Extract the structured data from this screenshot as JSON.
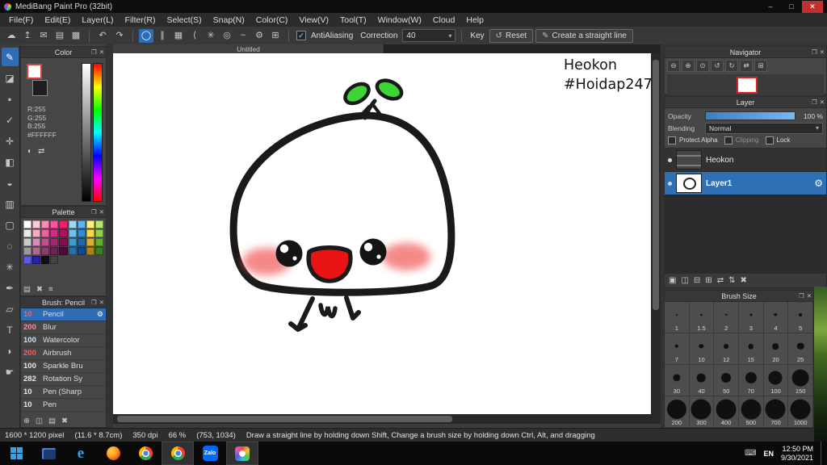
{
  "window": {
    "title": "MediBang Paint Pro (32bit)"
  },
  "glyphs": {
    "minimize": "–",
    "maximize": "□",
    "close": "✕",
    "popout": "❐",
    "undo": "↶",
    "redo": "↷",
    "caret": "▾",
    "check": "✓",
    "gear": "⚙",
    "reset_arrow": "↺",
    "pencil": "✎",
    "keyboard": "⌨"
  },
  "menu": {
    "items": [
      "File(F)",
      "Edit(E)",
      "Layer(L)",
      "Filter(R)",
      "Select(S)",
      "Snap(N)",
      "Color(C)",
      "View(V)",
      "Tool(T)",
      "Window(W)",
      "Cloud",
      "Help"
    ]
  },
  "toolbar": {
    "file_icons": [
      {
        "name": "cloud",
        "glyph": "☁"
      },
      {
        "name": "upload",
        "glyph": "↥"
      },
      {
        "name": "comment",
        "glyph": "✉"
      },
      {
        "name": "memo",
        "glyph": "▤"
      },
      {
        "name": "material",
        "glyph": "▩"
      }
    ],
    "snap_icons": [
      {
        "name": "snap-off",
        "glyph": "◯",
        "selected": true
      },
      {
        "name": "snap-parallel",
        "glyph": "∥"
      },
      {
        "name": "snap-grid",
        "glyph": "▦"
      },
      {
        "name": "snap-vanishing",
        "glyph": "⟨"
      },
      {
        "name": "snap-radial",
        "glyph": "✳"
      },
      {
        "name": "snap-circle",
        "glyph": "◎"
      },
      {
        "name": "snap-curve",
        "glyph": "~"
      },
      {
        "name": "snap-settings",
        "glyph": "⚙"
      },
      {
        "name": "snap-more",
        "glyph": "⊞"
      }
    ],
    "antialiasing_label": "AntiAliasing",
    "correction_label": "Correction",
    "correction_value": "40",
    "key_label": "Key",
    "reset_label": "Reset",
    "straight_line_label": "Create a straight line"
  },
  "tools": {
    "items": [
      {
        "name": "brush",
        "glyph": "✎",
        "selected": true
      },
      {
        "name": "eraser",
        "glyph": "◪"
      },
      {
        "name": "dot-pen",
        "glyph": "▪"
      },
      {
        "name": "select-pen",
        "glyph": "✓"
      },
      {
        "name": "move",
        "glyph": "✛"
      },
      {
        "name": "fill",
        "glyph": "◧"
      },
      {
        "name": "bucket",
        "glyph": "◒"
      },
      {
        "name": "gradient",
        "glyph": "▥"
      },
      {
        "name": "select-rect",
        "glyph": "▢"
      },
      {
        "name": "select-lasso",
        "glyph": "◌"
      },
      {
        "name": "magic-wand",
        "glyph": "✳"
      },
      {
        "name": "pen-tool",
        "glyph": "✒"
      },
      {
        "name": "operation",
        "glyph": "▱"
      },
      {
        "name": "text",
        "glyph": "T"
      },
      {
        "name": "eyedropper",
        "glyph": "◗"
      },
      {
        "name": "hand",
        "glyph": "☛"
      }
    ]
  },
  "color_panel": {
    "title": "Color",
    "r": "R:255",
    "g": "G:255",
    "b": "B:255",
    "hex": "#FFFFFF",
    "icons": [
      {
        "name": "web-color",
        "glyph": "◐"
      },
      {
        "name": "swap-color",
        "glyph": "⇄"
      }
    ]
  },
  "palette_panel": {
    "title": "Palette",
    "colors": [
      "#ffffff",
      "#ffc6dd",
      "#ff8ab8",
      "#ff4fa0",
      "#f31d6e",
      "#9bd9f5",
      "#58b6f0",
      "#fff27a",
      "#b8e86b",
      "#e8e8e8",
      "#f7a7c8",
      "#ef5fa0",
      "#d62a86",
      "#b01060",
      "#6cc2ef",
      "#2e8fd0",
      "#f5d94e",
      "#8fd24a",
      "#c9c9c9",
      "#d98ab8",
      "#c05090",
      "#a02870",
      "#800f50",
      "#3e9ad0",
      "#1a6ab0",
      "#d8b030",
      "#5fae32",
      "#9a9a9a",
      "#b06a92",
      "#903a70",
      "#702050",
      "#500a38",
      "#2a70a8",
      "#104c88",
      "#a88618",
      "#3a8020",
      "#5a5aee",
      "#2222aa",
      "#111111",
      "#444444"
    ],
    "footer_icons": [
      {
        "name": "add-color",
        "glyph": "▤"
      },
      {
        "name": "delete-color",
        "glyph": "✖"
      },
      {
        "name": "palette-menu",
        "glyph": "≡"
      }
    ]
  },
  "brush_panel": {
    "title": "Brush: Pencil",
    "brushes": [
      {
        "size": "10",
        "name": "Pencil",
        "size_color": "#ff5c5c",
        "selected": true
      },
      {
        "size": "200",
        "name": "Blur",
        "size_color": "#ff8aa0",
        "selected": false
      },
      {
        "size": "100",
        "name": "Watercolor",
        "size_color": "#cfe0ff",
        "selected": false
      },
      {
        "size": "200",
        "name": "Airbrush",
        "size_color": "#ff5c5c",
        "selected": false
      },
      {
        "size": "100",
        "name": "Sparkle Bru",
        "size_color": "#e8e8e8",
        "selected": false
      },
      {
        "size": "282",
        "name": "Rotation Sy",
        "size_color": "#e8e8e8",
        "selected": false
      },
      {
        "size": "10",
        "name": "Pen (Sharp",
        "size_color": "#e8e8e8",
        "selected": false
      },
      {
        "size": "10",
        "name": "Pen",
        "size_color": "#e8e8e8",
        "selected": false
      }
    ],
    "footer_icons": [
      {
        "name": "add-brush",
        "glyph": "⊕"
      },
      {
        "name": "duplicate-brush",
        "glyph": "◫"
      },
      {
        "name": "brush-folder",
        "glyph": "▤"
      },
      {
        "name": "delete-brush",
        "glyph": "✖"
      }
    ]
  },
  "canvas": {
    "tab": "Untitled",
    "signature_line1": "Heokon",
    "signature_line2": "#Hoidap247"
  },
  "artwork": {
    "outline": "#1a1a1a",
    "leaf_green": "#3fd435",
    "mouth_red": "#e81414",
    "blush_pink": "#f25858",
    "body_white": "#ffffff"
  },
  "navigator": {
    "title": "Navigator",
    "icons": [
      {
        "name": "zoom-out",
        "glyph": "⊖"
      },
      {
        "name": "zoom-in",
        "glyph": "⊕"
      },
      {
        "name": "zoom-100",
        "glyph": "⊙"
      },
      {
        "name": "rotate-left",
        "glyph": "↺"
      },
      {
        "name": "rotate-right",
        "glyph": "↻"
      },
      {
        "name": "flip-horizontal",
        "glyph": "⇄"
      },
      {
        "name": "fit-window",
        "glyph": "⊞"
      }
    ]
  },
  "layer_panel": {
    "title": "Layer",
    "opacity_label": "Opacity",
    "opacity_value": "100 %",
    "blending_label": "Blending",
    "blending_value": "Normal",
    "checkboxes": [
      {
        "label": "Protect Alpha",
        "dim": false
      },
      {
        "label": "Clipping",
        "dim": true
      },
      {
        "label": "Lock",
        "dim": false
      }
    ],
    "layers": [
      {
        "name": "Heokon",
        "selected": false,
        "thumb": "text"
      },
      {
        "name": "Layer1",
        "selected": true,
        "thumb": "drawing"
      }
    ],
    "footer_icons": [
      {
        "name": "new-layer",
        "glyph": "▣"
      },
      {
        "name": "duplicate-layer",
        "glyph": "◫"
      },
      {
        "name": "merge-layer",
        "glyph": "⊟"
      },
      {
        "name": "new-folder",
        "glyph": "⊞"
      },
      {
        "name": "transfer-layer",
        "glyph": "⇄"
      },
      {
        "name": "reorder-layer",
        "glyph": "⇅"
      },
      {
        "name": "delete-layer",
        "glyph": "✖"
      }
    ]
  },
  "brush_size_panel": {
    "title": "Brush Size",
    "sizes": [
      "1",
      "1.5",
      "2",
      "3",
      "4",
      "5",
      "7",
      "10",
      "12",
      "15",
      "20",
      "25",
      "30",
      "40",
      "50",
      "70",
      "100",
      "150",
      "200",
      "300",
      "400",
      "500",
      "700",
      "1000"
    ]
  },
  "status_bar": {
    "size": "1600 * 1200 pixel",
    "dimensions": "(11.6 * 8.7cm)",
    "dpi": "350 dpi",
    "zoom": "66 %",
    "coords": "(753, 1034)",
    "tip": "Draw a straight line by holding down Shift, Change a brush size by holding down Ctrl, Alt, and dragging"
  },
  "taskbar": {
    "zalo_label": "Zalo",
    "tray_lang": "EN",
    "time": "12:50 PM",
    "date": "9/30/2021"
  }
}
